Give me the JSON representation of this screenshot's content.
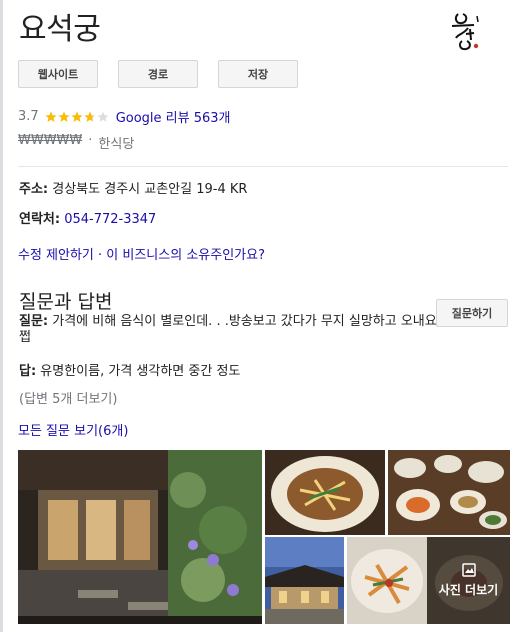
{
  "place": {
    "name": "요석궁",
    "logo_text": "요석궁"
  },
  "actions": {
    "website": "웹사이트",
    "directions": "경로",
    "save": "저장"
  },
  "rating": {
    "score": "3.7",
    "stars_value": 3.7,
    "stars_max": 5,
    "reviews_label": "Google 리뷰 563개"
  },
  "category": {
    "price": "₩₩₩₩₩",
    "separator": "·",
    "type": "한식당"
  },
  "details": {
    "address_label": "주소:",
    "address_value": "경상북도 경주시 교촌안길 19-4 KR",
    "phone_label": "연락처:",
    "phone_value": "054-772-3347"
  },
  "suggest": {
    "text": "수정 제안하기 · 이 비즈니스의 소유주인가요?"
  },
  "qa": {
    "title": "질문과 답변",
    "ask_button": "질문하기",
    "question_label": "질문:",
    "question_text": " 가격에 비해 음식이 별로인데. . .방송보고 갔다가 무지 실망하고 오내요 쩝",
    "answer_label": "답:",
    "answer_text": " 유명한이름, 가격 생각하면 중간 정도",
    "more_answers": "(답변 5개 더보기)",
    "all_questions": "모든 질문 보기(6개)"
  },
  "photos": {
    "more_label": "사진 더보기",
    "more_icon": "photo-icon"
  },
  "colors": {
    "link": "#1a0dab",
    "star": "#fbbc04",
    "star_empty": "#dadce0",
    "muted": "#70757a"
  }
}
